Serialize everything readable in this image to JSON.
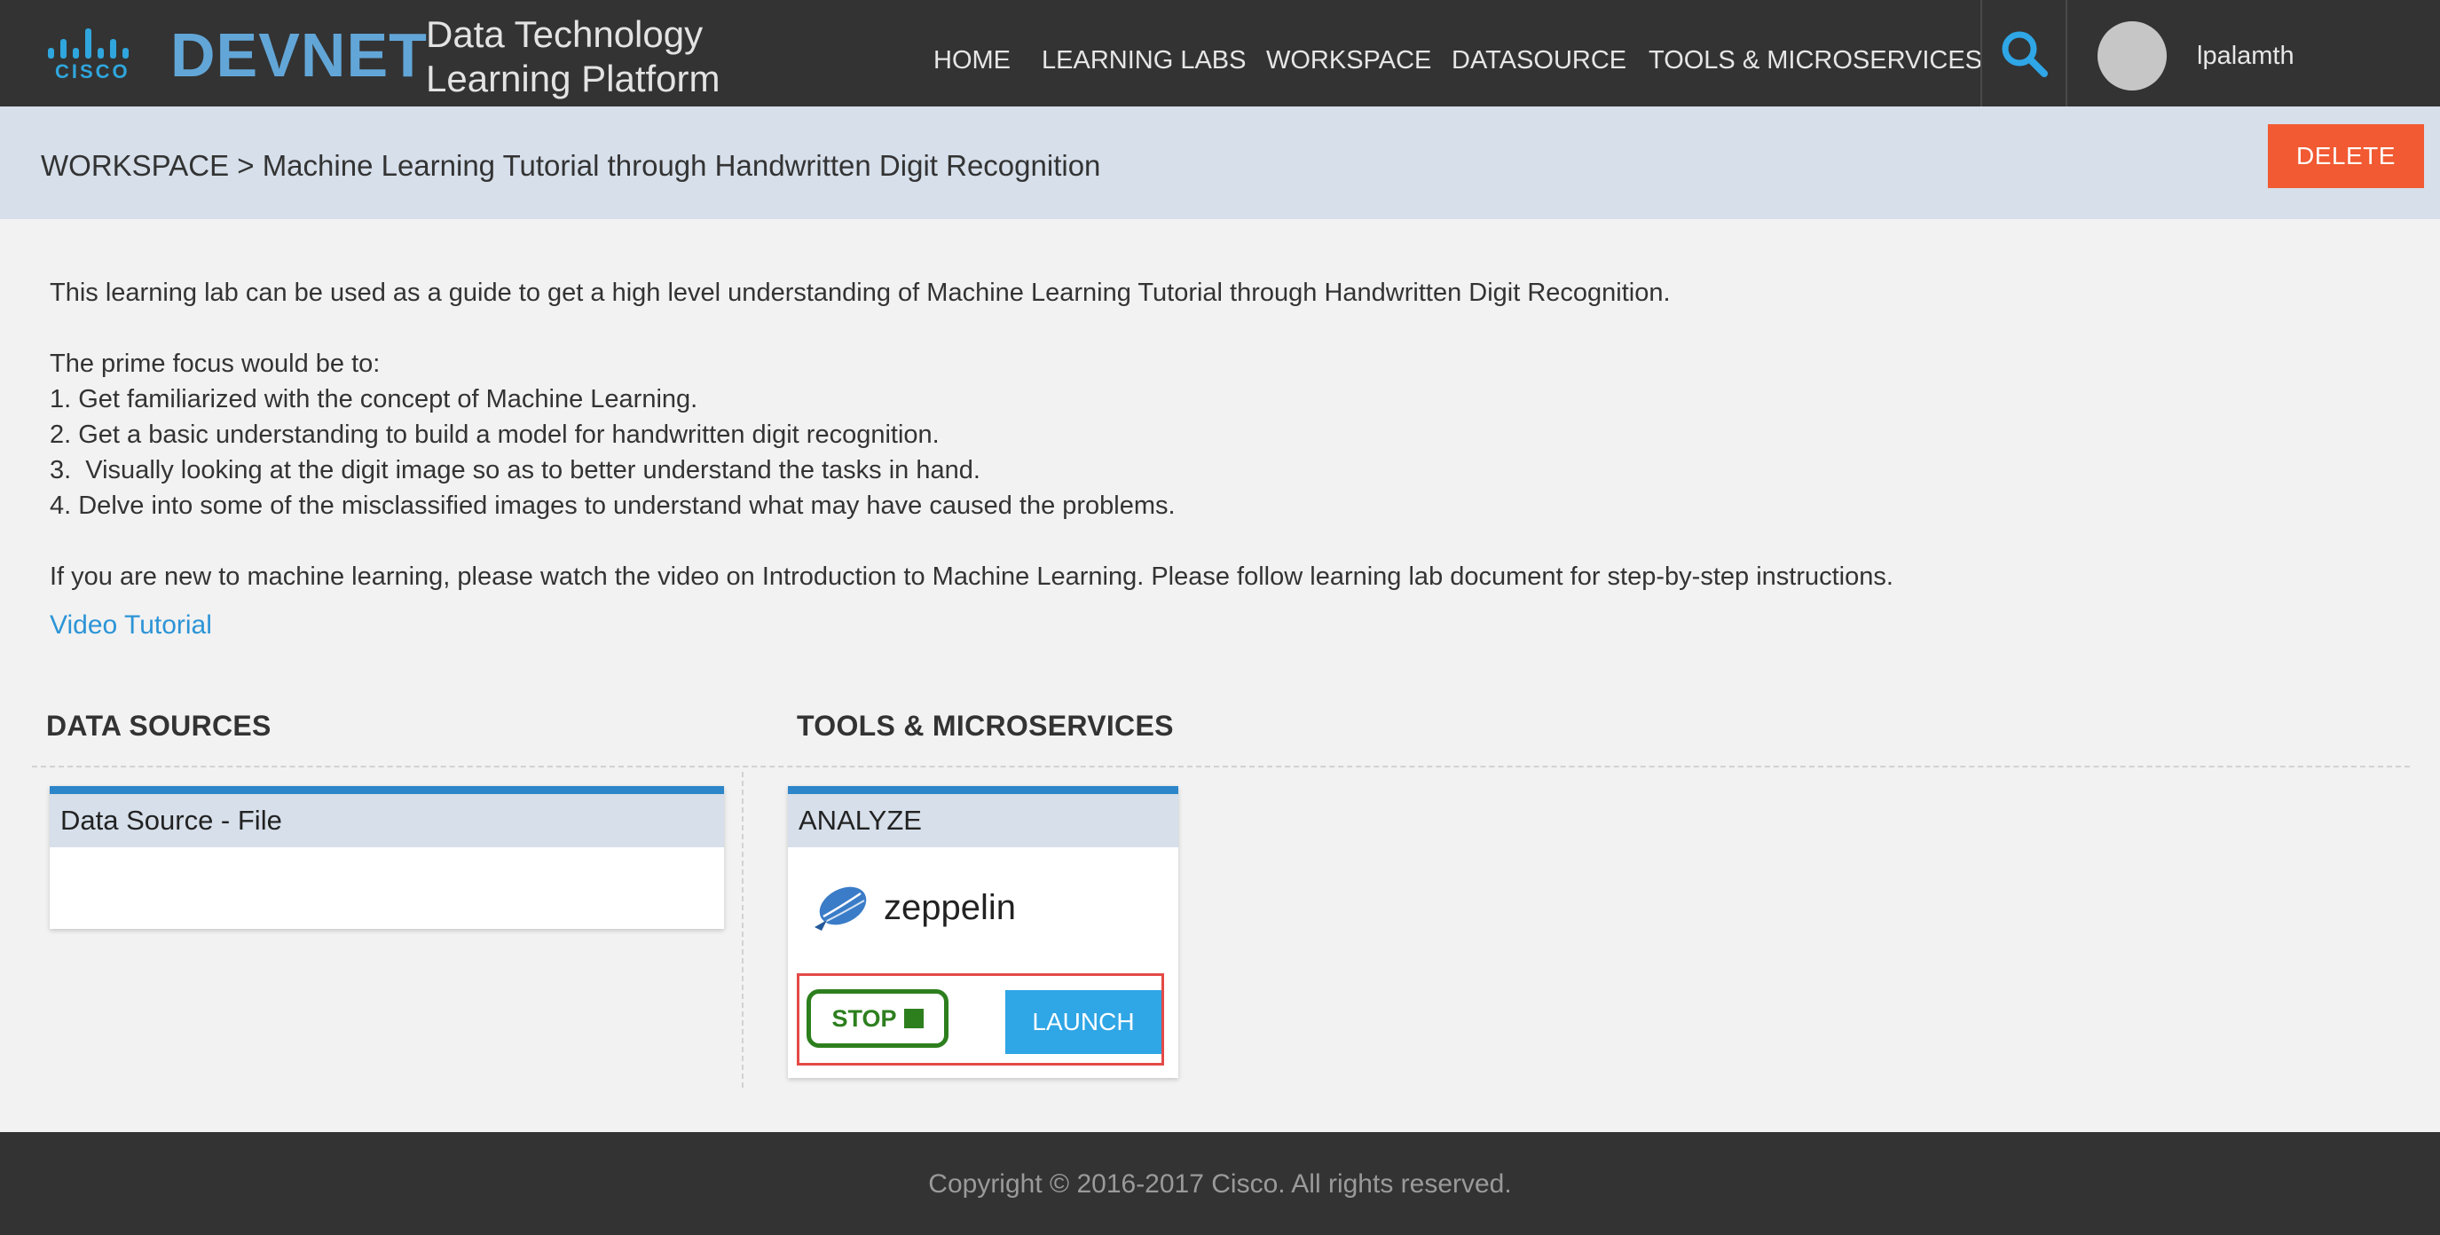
{
  "header": {
    "brand_cisco": "CISCO",
    "brand_devnet": "DEVNET",
    "platform_line1": "Data Technology",
    "platform_line2": "Learning Platform",
    "nav": [
      "HOME",
      "LEARNING LABS",
      "WORKSPACE",
      "DATASOURCE",
      "TOOLS & MICROSERVICES"
    ],
    "search_icon": "search-icon",
    "username": "lpalamth"
  },
  "breadcrumb": {
    "text": "WORKSPACE > Machine Learning Tutorial through Handwritten Digit Recognition",
    "delete_label": "DELETE"
  },
  "description": {
    "intro": "This learning lab can be used as a guide to get a high level understanding of Machine Learning Tutorial through Handwritten Digit Recognition.",
    "focus_heading": "The prime focus would be to:",
    "items": [
      "1. Get familiarized with the concept of Machine Learning.",
      "2. Get a basic understanding to build a model for handwritten digit recognition.",
      "3.  Visually looking at the digit image so as to better understand the tasks in hand.",
      "4. Delve into some of the misclassified images to understand what may have caused the problems."
    ],
    "outro": "If you are new to machine learning, please watch the video on Introduction to Machine Learning. Please follow learning lab document for step-by-step instructions.",
    "video_link": "Video Tutorial"
  },
  "sections": {
    "data_sources_title": "DATA SOURCES",
    "tools_title": "TOOLS & MICROSERVICES"
  },
  "data_source_card": {
    "title": "Data Source - File"
  },
  "analyze_card": {
    "title": "ANALYZE",
    "tool_name": "zeppelin",
    "stop_label": "STOP",
    "launch_label": "LAUNCH"
  },
  "footer": {
    "copyright": "Copyright © 2016-2017 Cisco. All rights reserved."
  },
  "colors": {
    "header_bg": "#333333",
    "accent_blue": "#2fa6e6",
    "delete_orange": "#f15a32",
    "stop_green": "#2d7f1e",
    "highlight_red": "#e44a46"
  }
}
